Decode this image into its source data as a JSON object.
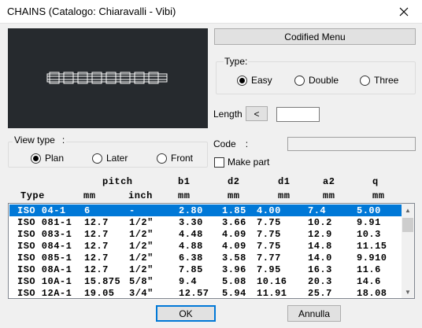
{
  "window": {
    "title": "CHAINS (Catalogo: Chiaravalli - Vibi)"
  },
  "buttons": {
    "codified_menu": "Codified Menu",
    "length_dec": "<",
    "ok": "OK",
    "cancel": "Annulla"
  },
  "type_group": {
    "label": "Type:",
    "options": [
      {
        "label": "Easy",
        "selected": true
      },
      {
        "label": "Double",
        "selected": false
      },
      {
        "label": "Three",
        "selected": false
      }
    ]
  },
  "length": {
    "label": "Length",
    "value": ""
  },
  "code": {
    "label": "Code",
    "colon": ":",
    "value": ""
  },
  "make_part": {
    "label": "Make part",
    "checked": false
  },
  "view_type": {
    "label": "View type",
    "colon": ":",
    "options": [
      {
        "label": "Plan",
        "selected": true
      },
      {
        "label": "Later",
        "selected": false
      },
      {
        "label": "Front",
        "selected": false
      }
    ]
  },
  "table": {
    "header_top": [
      "pitch",
      "b1",
      "d2",
      "d1",
      "a2",
      "q"
    ],
    "header_bottom": [
      "Type",
      "mm",
      "inch",
      "mm",
      "mm",
      "mm",
      "mm",
      "mm"
    ],
    "rows": [
      [
        "ISO 04-1",
        "6",
        "-",
        "2.80",
        "1.85",
        "4.00",
        "7.4",
        "5.00"
      ],
      [
        "ISO 081-1",
        "12.7",
        "1/2\"",
        "3.30",
        "3.66",
        "7.75",
        "10.2",
        "9.91"
      ],
      [
        "ISO 083-1",
        "12.7",
        "1/2\"",
        "4.48",
        "4.09",
        "7.75",
        "12.9",
        "10.3"
      ],
      [
        "ISO 084-1",
        "12.7",
        "1/2\"",
        "4.88",
        "4.09",
        "7.75",
        "14.8",
        "11.15"
      ],
      [
        "ISO 085-1",
        "12.7",
        "1/2\"",
        "6.38",
        "3.58",
        "7.77",
        "14.0",
        "9.910"
      ],
      [
        "ISO 08A-1",
        "12.7",
        "1/2\"",
        "7.85",
        "3.96",
        "7.95",
        "16.3",
        "11.6"
      ],
      [
        "ISO 10A-1",
        "15.875",
        "5/8\"",
        "9.4",
        "5.08",
        "10.16",
        "20.3",
        "14.6"
      ],
      [
        "ISO 12A-1",
        "19.05",
        "3/4\"",
        "12.57",
        "5.94",
        "11.91",
        "25.7",
        "18.08"
      ]
    ],
    "selected_index": 0
  },
  "colors": {
    "selection": "#0078d7",
    "preview_bg": "#262a2e"
  }
}
